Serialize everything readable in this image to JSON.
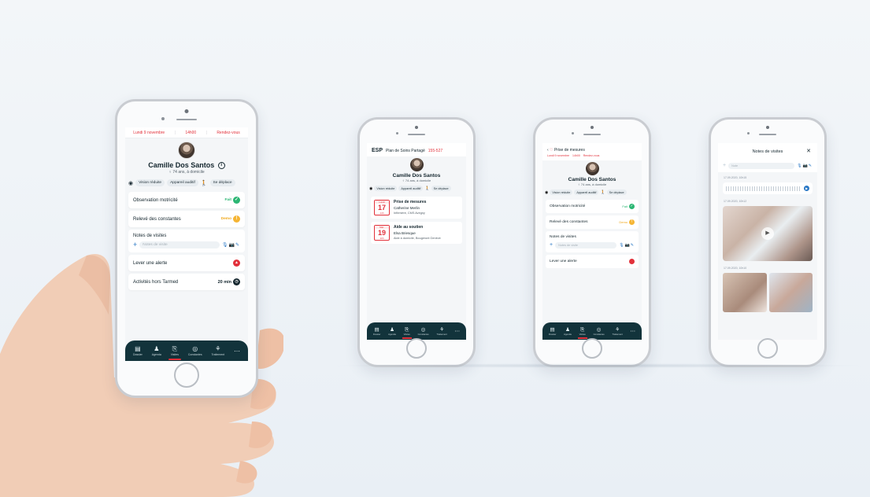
{
  "main": {
    "alerts": [
      "Lundi 9 novembre",
      "14h00",
      "Rendez-vous"
    ],
    "patient_name": "Camille Dos Santos",
    "patient_info_icon": "info-icon",
    "patient_sub": "♀ 74 ans, à domicile",
    "chips": [
      "Vision réduite",
      "Appareil auditif",
      "Se déplace"
    ],
    "cards": {
      "observation": "Observation motricité",
      "observation_status": "Fait",
      "releve": "Relevé des constantes",
      "releve_status": "Demo",
      "notes_title": "Notes de visites",
      "notes_placeholder": "Notes de visite",
      "alert": "Lever une alerte",
      "activity": "Activités hors Tarmed",
      "activity_value": "20 min"
    },
    "tabs": [
      "Dossier",
      "Agenda",
      "Visites",
      "Constantes",
      "Traitement"
    ]
  },
  "screen2": {
    "header_logo": "ESP",
    "header_title": "Plan de Soins Partagé",
    "header_ref": "155-527",
    "name": "Camille Dos Santos",
    "sub": "♀ 74 ans, à domicile",
    "chips": [
      "Vision réduite",
      "Appareil auditif",
      "Se déplace"
    ],
    "appointments": [
      {
        "month": "Lundi",
        "day": "17",
        "hour": "14h",
        "title": "Prise de mesures",
        "person": "Catherine Merlin",
        "loc": "Infirmière, CMS Avegny"
      },
      {
        "month": "Mar.",
        "day": "19",
        "hour": "10h",
        "title": "Aide au soutien",
        "person": "Elsa Briesque",
        "loc": "Aide à domicile, Bougeront Genève"
      }
    ],
    "tabs": [
      "Dossier",
      "Agenda",
      "Visites",
      "Constantes",
      "Traitement"
    ]
  },
  "screen3": {
    "header_title": "Prise de mesures",
    "header_meta": [
      "Lundi 9 novembre",
      "14h00",
      "Rendez-vous"
    ],
    "name": "Camille Dos Santos",
    "sub": "♀ 74 ans, à domicile",
    "chips": [
      "Vision réduite",
      "Appareil auditif",
      "Se déplace"
    ],
    "cards": {
      "observation": "Observation motricité",
      "observation_status": "Fait",
      "releve": "Relevé des constantes",
      "releve_status": "Demo",
      "notes_title": "Notes de visites",
      "notes_placeholder": "Notes de visite",
      "alert": "Lever une alerte"
    },
    "tabs": [
      "Dossier",
      "Agenda",
      "Visites",
      "Constantes",
      "Traitement"
    ]
  },
  "screen4": {
    "header_title": "Notes de visites",
    "input_placeholder": "Note",
    "entries": [
      "17.09.2020, 10h15",
      "17.09.2020, 10h12",
      "17.09.2020, 10h10"
    ]
  }
}
